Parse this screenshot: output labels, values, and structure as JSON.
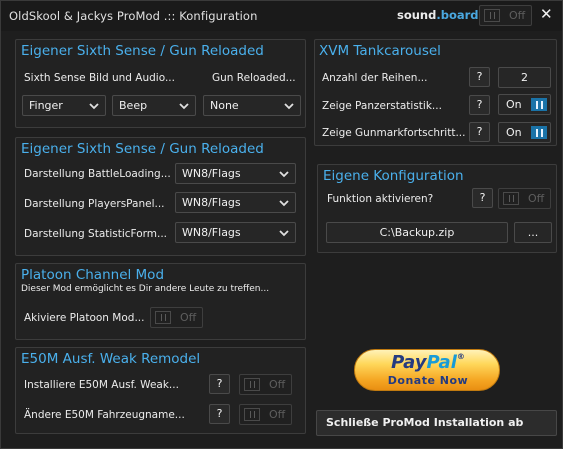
{
  "window": {
    "title": "OldSkool & Jackys ProMod .:: Konfiguration",
    "sound_prefix": "sound",
    "sound_dot": ".",
    "sound_suffix": "board:",
    "sound_toggle": "Off",
    "close": "✕"
  },
  "sixth_sense_top": {
    "title": "Eigener Sixth Sense / Gun Reloaded",
    "label_left": "Sixth Sense Bild und Audio...",
    "label_right": "Gun Reloaded...",
    "select1": "Finger",
    "select2": "Beep",
    "select3": "None"
  },
  "sixth_sense_display": {
    "title": "Eigener Sixth Sense / Gun Reloaded",
    "rows": [
      {
        "label": "Darstellung BattleLoading...",
        "value": "WN8/Flags"
      },
      {
        "label": "Darstellung PlayersPanel...",
        "value": "WN8/Flags"
      },
      {
        "label": "Darstellung StatisticForm...",
        "value": "WN8/Flags"
      }
    ]
  },
  "platoon": {
    "title": "Platoon Channel Mod",
    "description": "Dieser Mod ermöglicht es Dir andere Leute zu treffen...",
    "label": "Akiviere Platoon Mod...",
    "toggle": "Off"
  },
  "e50m": {
    "title": "E50M Ausf. Weak Remodel",
    "rows": [
      {
        "label": "Installiere E50M Ausf. Weak...",
        "help": "?",
        "toggle": "Off"
      },
      {
        "label": "Ändere E50M Fahrzeugname...",
        "help": "?",
        "toggle": "Off"
      }
    ]
  },
  "xvm": {
    "title": "XVM Tankcarousel",
    "rows": [
      {
        "label": "Anzahl der Reihen...",
        "help": "?",
        "value": "2"
      },
      {
        "label": "Zeige Panzerstatistik...",
        "help": "?",
        "toggle": "On"
      },
      {
        "label": "Zeige Gunmarkfortschritt...",
        "help": "?",
        "toggle": "On"
      }
    ]
  },
  "custom": {
    "title": "Eigene Konfiguration",
    "label": "Funktion aktivieren?",
    "help": "?",
    "toggle": "Off",
    "path": "C:\\Backup.zip",
    "browse": "..."
  },
  "paypal": {
    "word1": "Pay",
    "word2": "Pal",
    "trademark": "®",
    "donate": "Donate Now"
  },
  "finish_button": "Schließe ProMod Installation ab"
}
